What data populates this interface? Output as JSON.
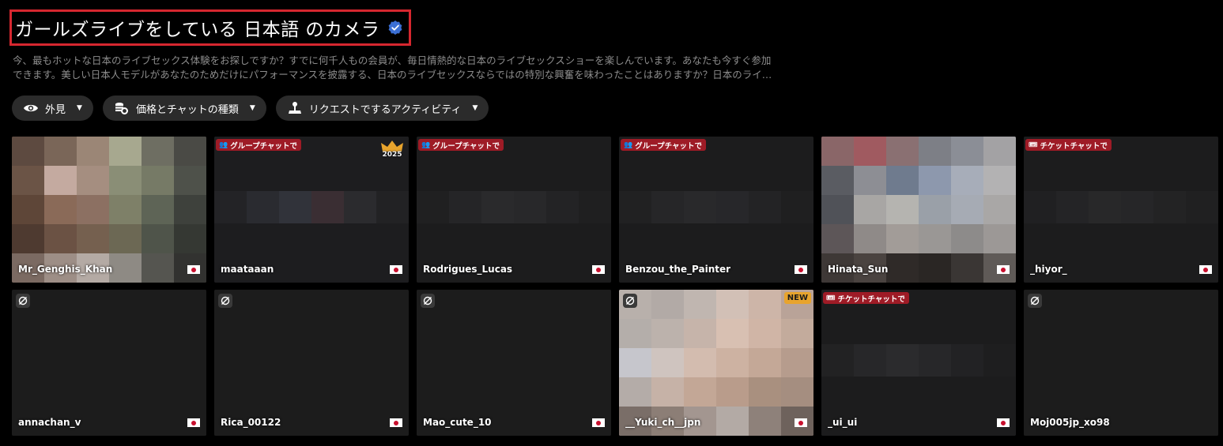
{
  "header": {
    "title": "ガールズライブをしている 日本語 のカメラ",
    "verified_icon": "verified-check-icon",
    "description_line1": "今、最もホットな日本のライブセックス体験をお探しですか？すでに何千人もの会員が、毎日情熱的な日本のライブセックスショーを楽しんでいます。あなたも今すぐ参加",
    "description_line2": "できます。美しい日本人モデルがあなたのためだけにパフォーマンスを披露する、日本のライブセックスならではの特別な興奮を味わったことはありますか？日本のライ…"
  },
  "filters": [
    {
      "label": "外見",
      "icon": "eye-icon"
    },
    {
      "label": "価格とチャットの種類",
      "icon": "coins-icon"
    },
    {
      "label": "リクエストでするアクティビティ",
      "icon": "joystick-icon"
    }
  ],
  "badges": {
    "group_chat": "グループチャットで",
    "ticket_chat": "チケットチャットで",
    "new": "NEW",
    "year": "2025"
  },
  "cards": [
    {
      "name": "Mr_Genghis_Khan"
    },
    {
      "name": "maataaan"
    },
    {
      "name": "Rodrigues_Lucas"
    },
    {
      "name": "Benzou_the_Painter"
    },
    {
      "name": "Hinata_Sun"
    },
    {
      "name": "_hiyor_"
    },
    {
      "name": "annachan_v"
    },
    {
      "name": "Rica_00122"
    },
    {
      "name": "Mao_cute_10"
    },
    {
      "name": "__Yuki_ch__jpn"
    },
    {
      "name": "_ui_ui"
    },
    {
      "name": "Moj005jp_xo98"
    }
  ],
  "colors": {
    "background": "#000000",
    "title_border": "#d6272f",
    "tag_red": "#9e1b26",
    "new_orange": "#e8a42d",
    "verified_blue": "#3b6fd4"
  }
}
